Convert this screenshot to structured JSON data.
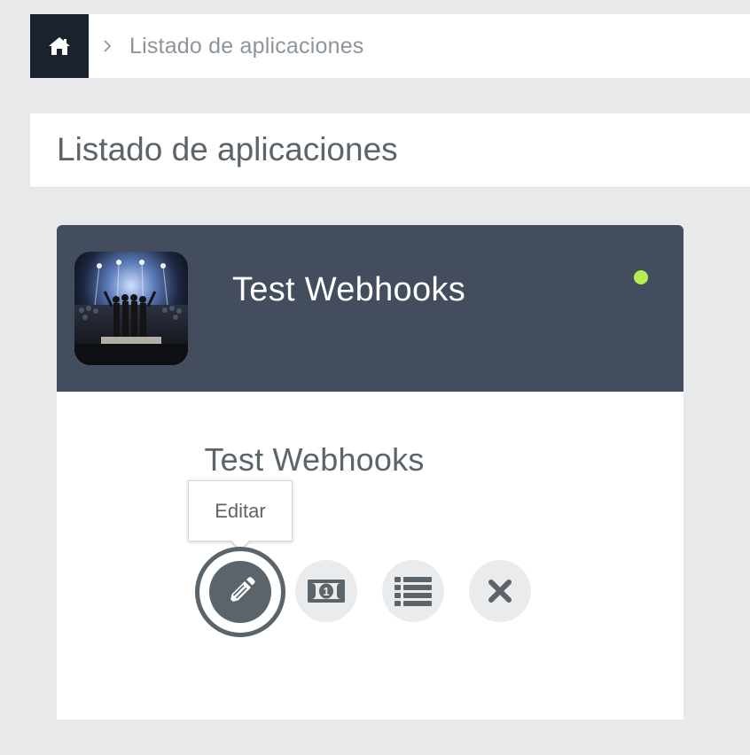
{
  "breadcrumb": {
    "home_icon": "home-icon",
    "separator_icon": "chevron-right-icon",
    "current": "Listado de aplicaciones"
  },
  "page": {
    "title": "Listado de aplicaciones"
  },
  "app_card": {
    "header_name": "Test Webhooks",
    "name": "Test Webhooks",
    "status_color": "#b5ee4e",
    "thumbnail_icon": "concert-photo",
    "header_color": "#434d5e"
  },
  "actions": {
    "tooltip": "Editar",
    "buttons": [
      {
        "name": "edit",
        "icon": "pencil-icon"
      },
      {
        "name": "billing",
        "icon": "money-bill-icon"
      },
      {
        "name": "list",
        "icon": "list-icon"
      },
      {
        "name": "delete",
        "icon": "close-icon"
      }
    ]
  }
}
